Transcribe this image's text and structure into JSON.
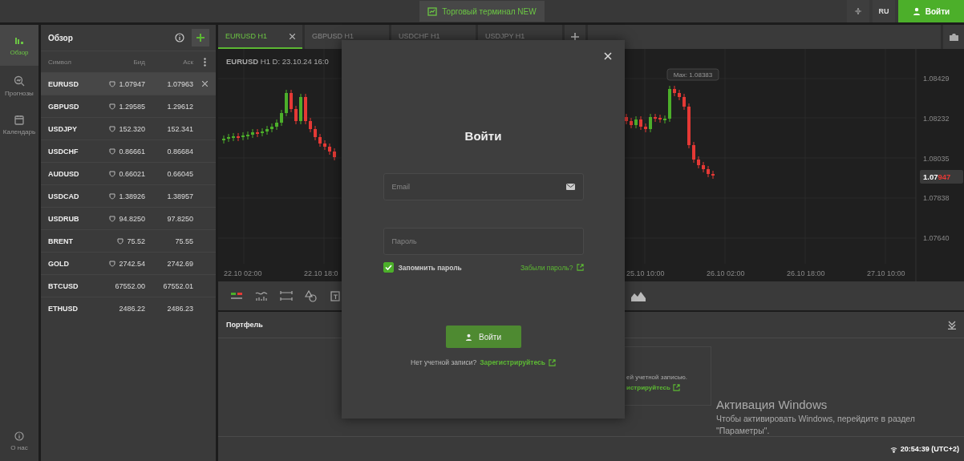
{
  "topbar": {
    "terminal_button": "Торговый терминал NEW",
    "language": "RU",
    "login_button": "Войти"
  },
  "nav": {
    "items": [
      {
        "label": "Обзор",
        "kind": "overview",
        "selected": true
      },
      {
        "label": "Прогнозы",
        "kind": "forecast",
        "selected": false
      },
      {
        "label": "Календарь",
        "kind": "calendar",
        "selected": false
      }
    ],
    "about": "О нас"
  },
  "watchlist": {
    "title": "Обзор",
    "columns": [
      "Символ",
      "Бид",
      "Аск"
    ],
    "rows": [
      {
        "symbol": "EURUSD",
        "bid": "1.07947",
        "ask": "1.07963",
        "alarm": true,
        "selected": true
      },
      {
        "symbol": "GBPUSD",
        "bid": "1.29585",
        "ask": "1.29612",
        "alarm": true,
        "selected": false
      },
      {
        "symbol": "USDJPY",
        "bid": "152.320",
        "ask": "152.341",
        "alarm": true,
        "selected": false
      },
      {
        "symbol": "USDCHF",
        "bid": "0.86661",
        "ask": "0.86684",
        "alarm": true,
        "selected": false
      },
      {
        "symbol": "AUDUSD",
        "bid": "0.66021",
        "ask": "0.66045",
        "alarm": true,
        "selected": false
      },
      {
        "symbol": "USDCAD",
        "bid": "1.38926",
        "ask": "1.38957",
        "alarm": true,
        "selected": false
      },
      {
        "symbol": "USDRUB",
        "bid": "94.8250",
        "ask": "97.8250",
        "alarm": true,
        "selected": false
      },
      {
        "symbol": "BRENT",
        "bid": "75.52",
        "ask": "75.55",
        "alarm": true,
        "selected": false
      },
      {
        "symbol": "GOLD",
        "bid": "2742.54",
        "ask": "2742.69",
        "alarm": true,
        "selected": false
      },
      {
        "symbol": "BTCUSD",
        "bid": "67552.00",
        "ask": "67552.01",
        "alarm": false,
        "selected": false
      },
      {
        "symbol": "ETHUSD",
        "bid": "2486.22",
        "ask": "2486.23",
        "alarm": false,
        "selected": false
      }
    ]
  },
  "tabs": [
    {
      "label": "EURUSD H1",
      "selected": true
    },
    {
      "label": "GBPUSD H1",
      "selected": false
    },
    {
      "label": "USDCHF H1",
      "selected": false
    },
    {
      "label": "USDJPY H1",
      "selected": false
    }
  ],
  "chart": {
    "symbol": "EURUSD",
    "timeframe": "H1",
    "date": "D: 23.10.24 16:0",
    "y_labels": [
      "1.08429",
      "1.08232",
      "1.08035",
      "1.07838",
      "1.07640"
    ],
    "price_tag": {
      "main": "1.07",
      "accent": "947"
    },
    "max_label": "Max: 1.08383",
    "x_labels_left": [
      "22.10 02:00",
      "22.10 18:0"
    ],
    "x_labels_right": [
      "25.10 10:00",
      "26.10 02:00",
      "26.10 18:00",
      "27.10 10:00"
    ]
  },
  "portfolio": {
    "title": "Портфель",
    "card_text": "ей учетной записью.",
    "card_link": "истрируйтесь",
    "clock": "20:54:39 (UTC+2)"
  },
  "login_dialog": {
    "title": "Войти",
    "email": {
      "placeholder": "Email"
    },
    "password": {
      "placeholder": "Пароль"
    },
    "remember": {
      "label": "Запомнить пароль",
      "checked": true
    },
    "forgot_link": "Забыли пароль?",
    "submit": "Войти",
    "footer_text": "Нет учетной записи?",
    "register_link": "Зарегистрируйтесь"
  },
  "os_notice": {
    "title": "Активация Windows",
    "text": "Чтобы активировать Windows, перейдите в раздел \"Параметры\"."
  }
}
